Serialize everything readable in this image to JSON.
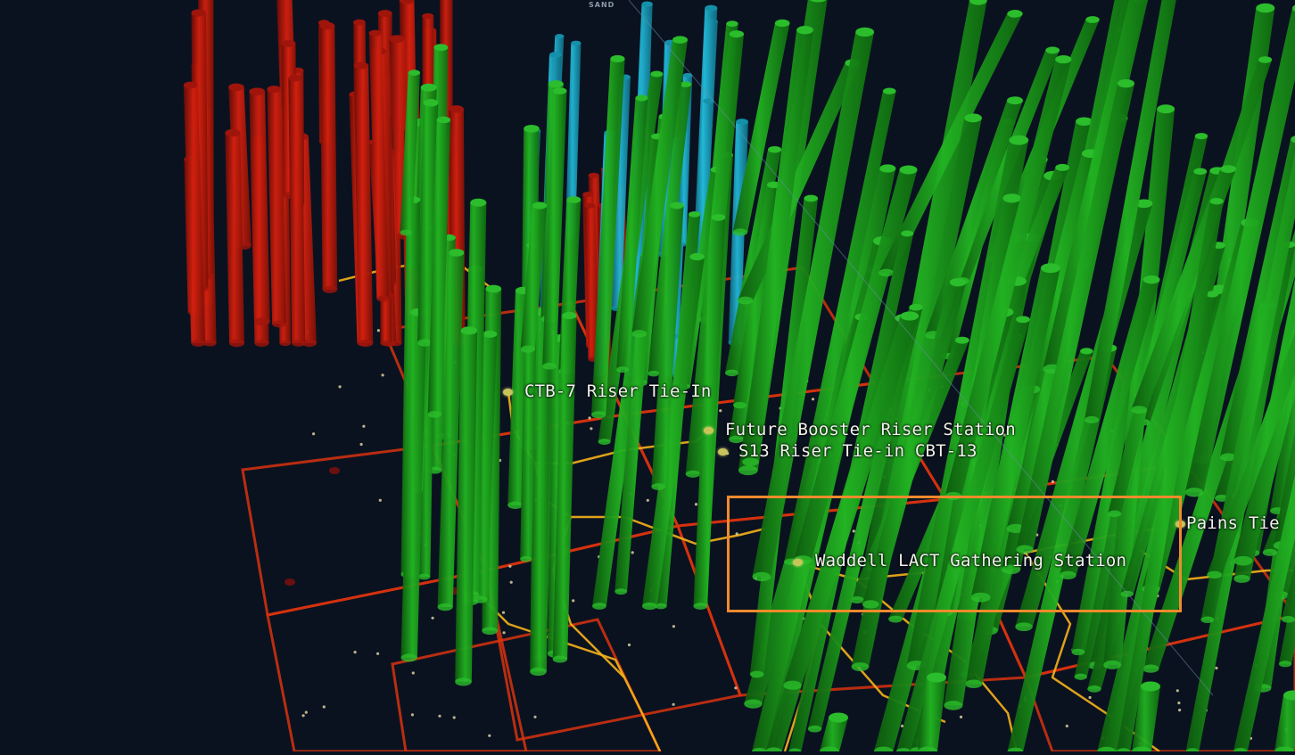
{
  "map": {
    "top_label": "SAND",
    "colors": {
      "background": "#0a1220",
      "producing_well": "#1fa01f",
      "shut_in_well": "#c0180e",
      "injection_well": "#19a6c4",
      "lease_boundary": "#d8320e",
      "pipeline": "#f5b21a",
      "selection": "#f08a2c",
      "label_text": "#f2f2ee",
      "facility_marker": "#c9c45a"
    },
    "facilities": [
      {
        "name": "CTB-7 Riser Tie-In"
      },
      {
        "name": "Future Booster Riser Station"
      },
      {
        "name": "S13 Riser Tie-in CBT-13"
      },
      {
        "name": "Waddell LACT Gathering Station"
      },
      {
        "name": "Pains Tie"
      }
    ],
    "selected_facility": "Waddell LACT Gathering Station"
  }
}
